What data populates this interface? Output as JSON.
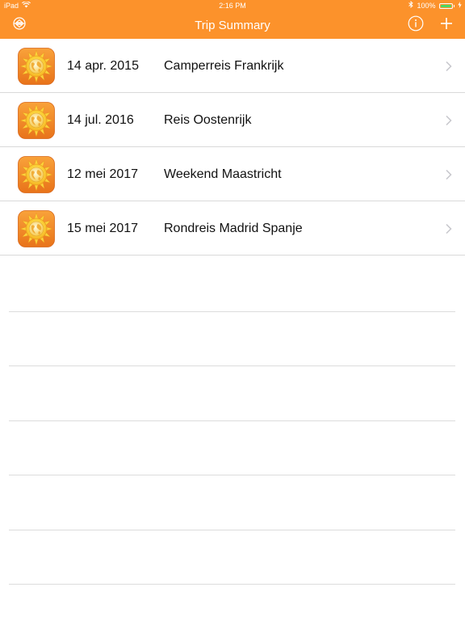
{
  "status_bar": {
    "device": "iPad",
    "time": "2:16 PM",
    "battery": "100%",
    "battery_level": 1.0,
    "wifi_icon": "wifi-icon",
    "bluetooth_icon": "bluetooth-icon"
  },
  "navbar": {
    "title": "Trip Summary",
    "left_icon": "sort-icon",
    "info_icon": "info-icon",
    "add_icon": "plus-icon",
    "color": "#fc922b"
  },
  "trips": [
    {
      "date": "14 apr. 2015",
      "name": "Camperreis Frankrijk"
    },
    {
      "date": "14 jul. 2016",
      "name": "Reis Oostenrijk"
    },
    {
      "date": "12 mei 2017",
      "name": "Weekend Maastricht"
    },
    {
      "date": "15 mei 2017",
      "name": "Rondreis Madrid Spanje"
    }
  ],
  "icons": {
    "trip_icon": "sun-globe-icon",
    "chevron": "chevron-right-icon"
  },
  "colors": {
    "accent": "#fc922b",
    "separator": "#d9d9d9",
    "chevron": "#c7c7cc",
    "text": "#111111"
  }
}
